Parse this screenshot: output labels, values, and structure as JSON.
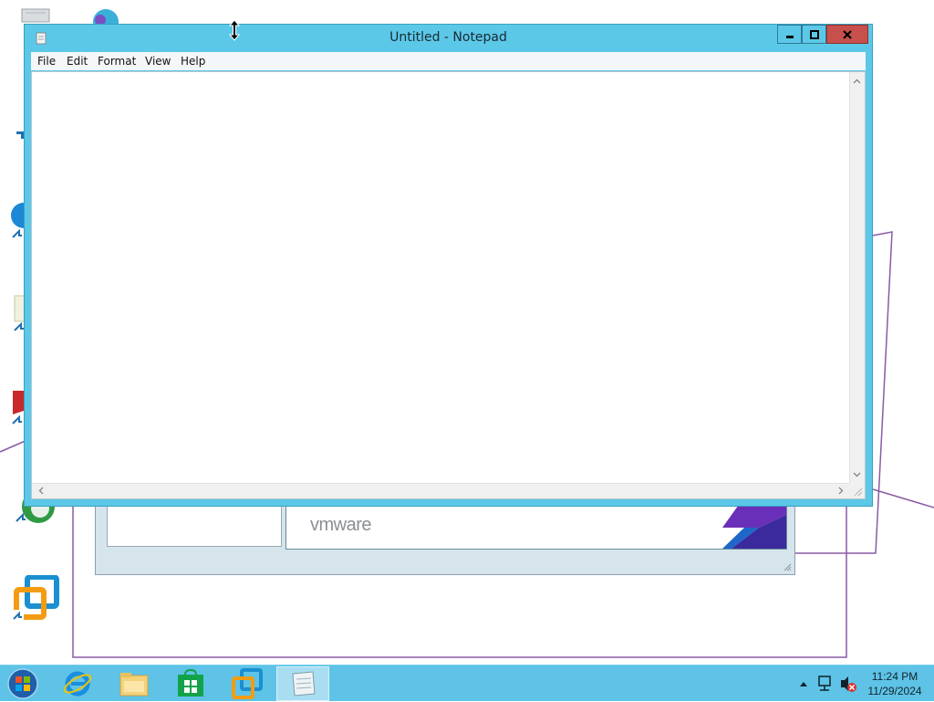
{
  "notepad": {
    "title": "Untitled - Notepad",
    "menu": [
      "File",
      "Edit",
      "Format",
      "View",
      "Help"
    ],
    "content": ""
  },
  "installer": {
    "brand": "vmware"
  },
  "taskbar": {
    "items": [
      {
        "name": "start-button",
        "icon": "windows-orb-icon"
      },
      {
        "name": "internet-explorer",
        "icon": "internet-explorer-icon"
      },
      {
        "name": "file-explorer",
        "icon": "folder-icon"
      },
      {
        "name": "store",
        "icon": "store-icon"
      },
      {
        "name": "vmware-workstation",
        "icon": "vmware-icon"
      },
      {
        "name": "notepad",
        "icon": "notepad-icon",
        "active": true
      }
    ],
    "clock": {
      "time": "11:24 PM",
      "date": "11/29/2024"
    }
  },
  "colors": {
    "window_frame": "#5cc8e8",
    "close_button": "#c7504d",
    "taskbar": "#5ec3e6",
    "outline": "#8a5aa6"
  }
}
